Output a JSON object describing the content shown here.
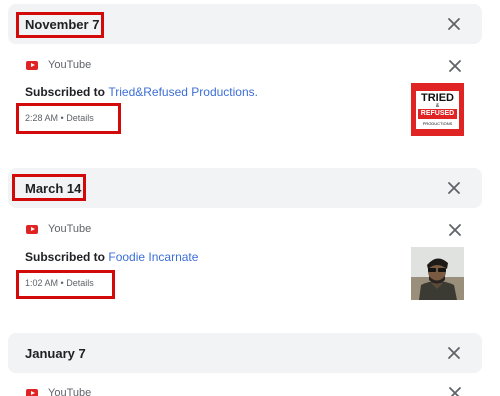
{
  "groups": [
    {
      "date": "November 7",
      "source": "YouTube",
      "action": "Subscribed to",
      "channel": "Tried&Refused Productions.",
      "time": "2:28 AM",
      "sep": "•",
      "details": "Details",
      "thumb_text": {
        "line1": "TRIED",
        "amp": "&",
        "line2": "REFUSED",
        "line3": "PRODUCTIONS"
      }
    },
    {
      "date": "March 14",
      "source": "YouTube",
      "action": "Subscribed to",
      "channel": "Foodie Incarnate",
      "time": "1:02 AM",
      "sep": "•",
      "details": "Details"
    },
    {
      "date": "January 7",
      "source": "YouTube"
    }
  ],
  "colors": {
    "link": "#3c6fd6",
    "highlight": "#d20a0a",
    "youtube": "#e02424",
    "header_bg": "#f1f3f4"
  },
  "icons": {
    "close": "close-icon",
    "youtube": "youtube-icon"
  }
}
